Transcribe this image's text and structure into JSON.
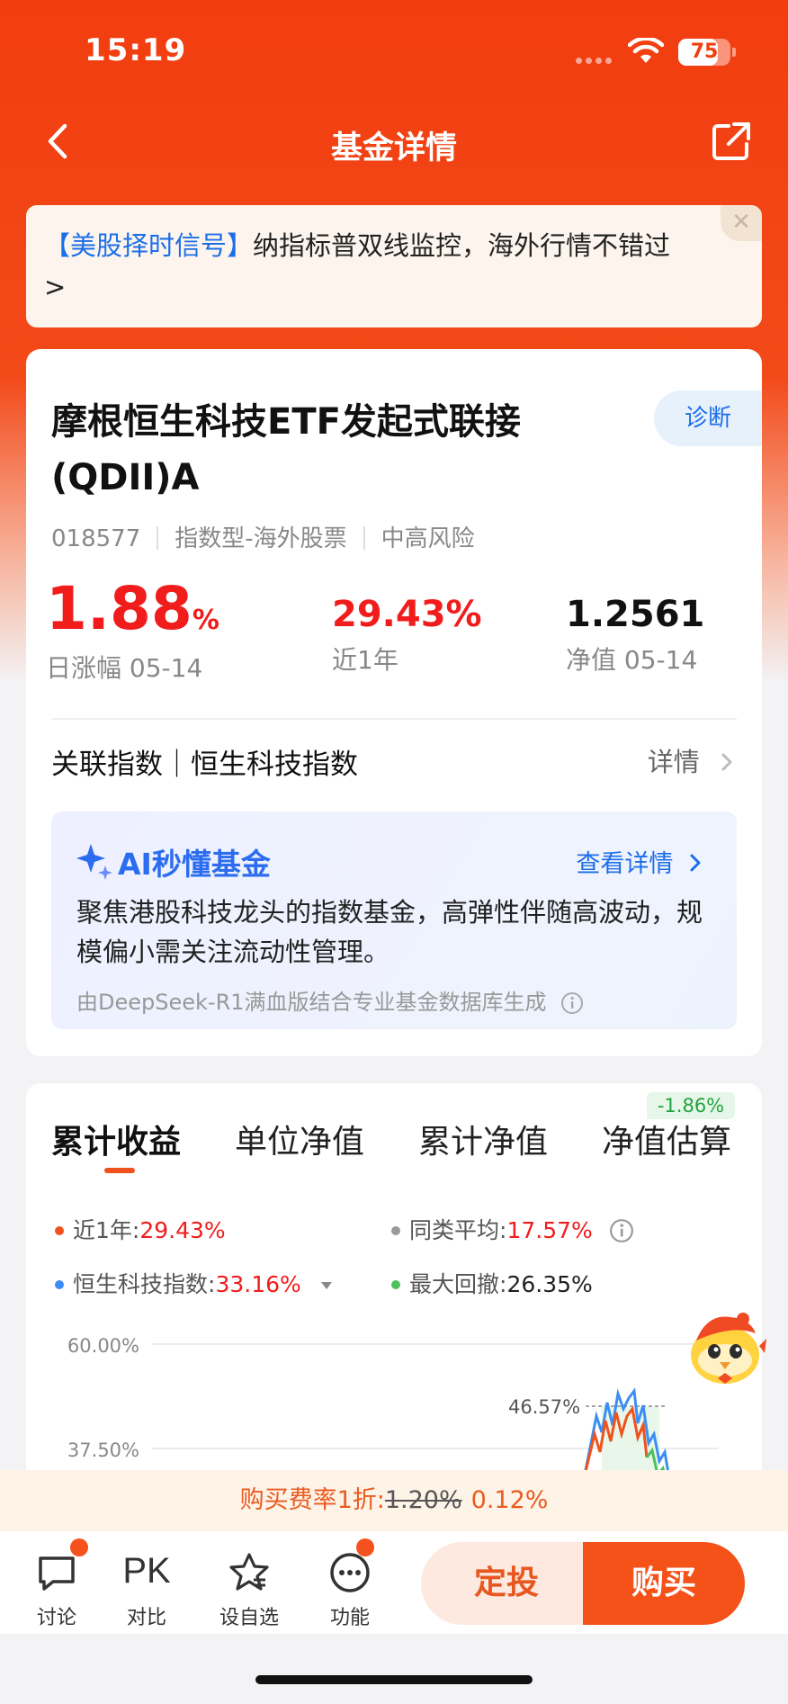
{
  "status_bar": {
    "time": "15:19",
    "battery": "75"
  },
  "nav": {
    "title": "基金详情"
  },
  "banner": {
    "highlight": "【美股择时信号】",
    "text": "纳指标普双线监控，海外行情不错过",
    "arrow": ">"
  },
  "fund": {
    "name_line1": "摩根恒生科技ETF发起式联接",
    "name_line2": "(QDII)A",
    "diagnose": "诊断",
    "code": "018577",
    "type": "指数型-海外股票",
    "risk": "中高风险",
    "daily_change": "1.88",
    "daily_change_unit": "%",
    "daily_label": "日涨幅 05-14",
    "one_year": "29.43%",
    "one_year_label": "近1年",
    "nav_value": "1.2561",
    "nav_label": "净值 05-14"
  },
  "index_row": {
    "label": "关联指数｜恒生科技指数",
    "detail": "详情"
  },
  "ai": {
    "title": "AI秒懂基金",
    "more": "查看详情",
    "body": "聚焦港股科技龙头的指数基金，高弹性伴随高波动，规模偏小需关注流动性管理。",
    "footer": "由DeepSeek-R1满血版结合专业基金数据库生成"
  },
  "tabs": [
    "累计收益",
    "单位净值",
    "累计净值",
    "净值估算"
  ],
  "estimate_badge": "-1.86%",
  "legend": {
    "fund_label": "近1年:",
    "fund_value": "29.43%",
    "avg_label": "同类平均:",
    "avg_value": "17.57%",
    "index_label": "恒生科技指数:",
    "index_value": "33.16%",
    "drawdown_label": "最大回撤:",
    "drawdown_value": "26.35%"
  },
  "chart_data": {
    "type": "line",
    "y_tick_labels": [
      "60.00%",
      "37.50%"
    ],
    "ylim_visible": [
      37.5,
      60
    ],
    "peak_annotation": "46.57%",
    "series": [
      {
        "name": "近1年",
        "color": "#f0521d"
      },
      {
        "name": "恒生科技指数",
        "color": "#3b8ef5"
      },
      {
        "name": "同类平均",
        "color": "#999999"
      }
    ]
  },
  "colors": {
    "brand": "#f23d0f",
    "up": "#f11c1c",
    "down": "#22a33b",
    "link": "#1c6ee8"
  },
  "fee": {
    "label": "购买费率1折:",
    "original": "1.20%",
    "discounted": "0.12%"
  },
  "bottom_bar": {
    "discuss": "讨论",
    "compare_icon": "PK",
    "compare": "对比",
    "watch": "设自选",
    "functions": "功能",
    "sip": "定投",
    "buy": "购买"
  }
}
